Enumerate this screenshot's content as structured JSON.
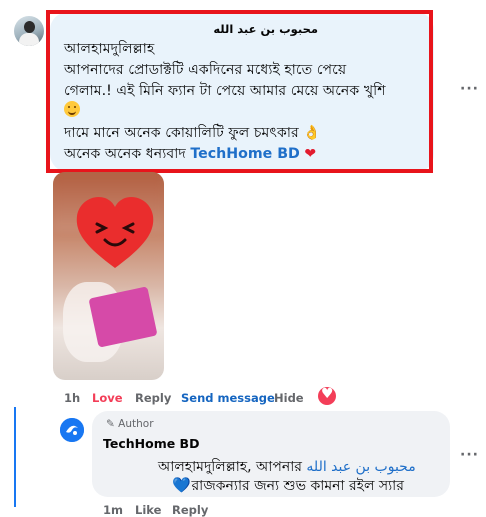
{
  "main_comment": {
    "author": "محبوب بن عبد الله",
    "lines": [
      "আলহামদুলিল্লাহ",
      "আপনাদের প্রোডাক্টটি একদিনের মধ্যেই হাতে পেয়ে",
      "গেলাম.! এই মিনি ফ্যান টা পেয়ে আমার মেয়ে অনেক খুশি",
      "দামে মানে অনেক কোয়ালিটি ফুল চমৎকার",
      "অনেক অনেক ধন্যবাদ"
    ],
    "brand_mention": "TechHome BD",
    "actions": {
      "time": "1h",
      "love": "Love",
      "reply": "Reply",
      "send_message": "Send message",
      "hide": "Hide"
    }
  },
  "reply_comment": {
    "badge": "Author",
    "author": "TechHome BD",
    "line1_prefix": "আলহামদুলিল্লাহ, আপনার",
    "line1_name": "মহবুব বিন আব্দ আল্লাহ",
    "line1_name_display": "محبوب بن عبد الله",
    "line2": "রাজকন্যার জন্য শুভ কামনা রইল স্যার",
    "actions": {
      "time": "1m",
      "like": "Like",
      "reply": "Reply"
    }
  },
  "more_label": "···",
  "colors": {
    "highlight_border": "#e8141b",
    "brand_blue": "#1f6fc9",
    "love_red": "#f33e58",
    "facebook_blue": "#1877f2",
    "bubble_blue": "#e9f3fb",
    "bubble_gray": "#f0f2f5"
  }
}
